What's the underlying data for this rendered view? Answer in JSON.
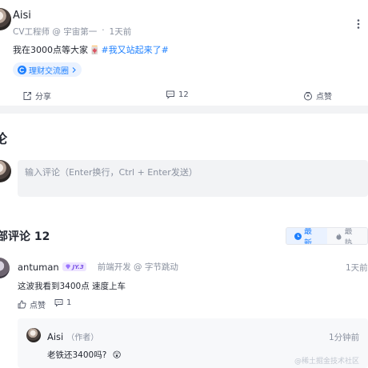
{
  "post": {
    "author_name": "Aisi",
    "author_job": "CV工程师 @ 宇宙第一",
    "separator": "·",
    "time": "1天前",
    "content_text": "我在3000点等大家",
    "content_emoji": "🀄",
    "hashtag": "#我又站起来了#",
    "circle_tag": "理财交流圈",
    "actions": {
      "share_label": "分享",
      "comment_count": "12",
      "like_label": "点赞"
    }
  },
  "comment_section": {
    "heading": "论",
    "input_placeholder": "输入评论（Enter换行，Ctrl + Enter发送）"
  },
  "all_comments": {
    "heading": "部评论",
    "count": "12",
    "sort_latest": "最新",
    "sort_hottest": "最热"
  },
  "comments": [
    {
      "author": "antuman",
      "level": "JY.3",
      "job": "前端开发 @ 字节跳动",
      "time": "1天前",
      "text": "这波我看到3400点 速度上车",
      "like_label": "点赞",
      "reply_count": "1",
      "replies": [
        {
          "author": "Aisi",
          "role": "（作者）",
          "time": "1分钟前",
          "text": "老铁还3400吗?",
          "emoji": "😲"
        }
      ]
    }
  ],
  "watermark": "@稀土掘金技术社区",
  "colors": {
    "accent": "#1e80ff",
    "muted": "#8a919f",
    "band": "#f2f3f5",
    "level_badge": "#7a52e6"
  }
}
